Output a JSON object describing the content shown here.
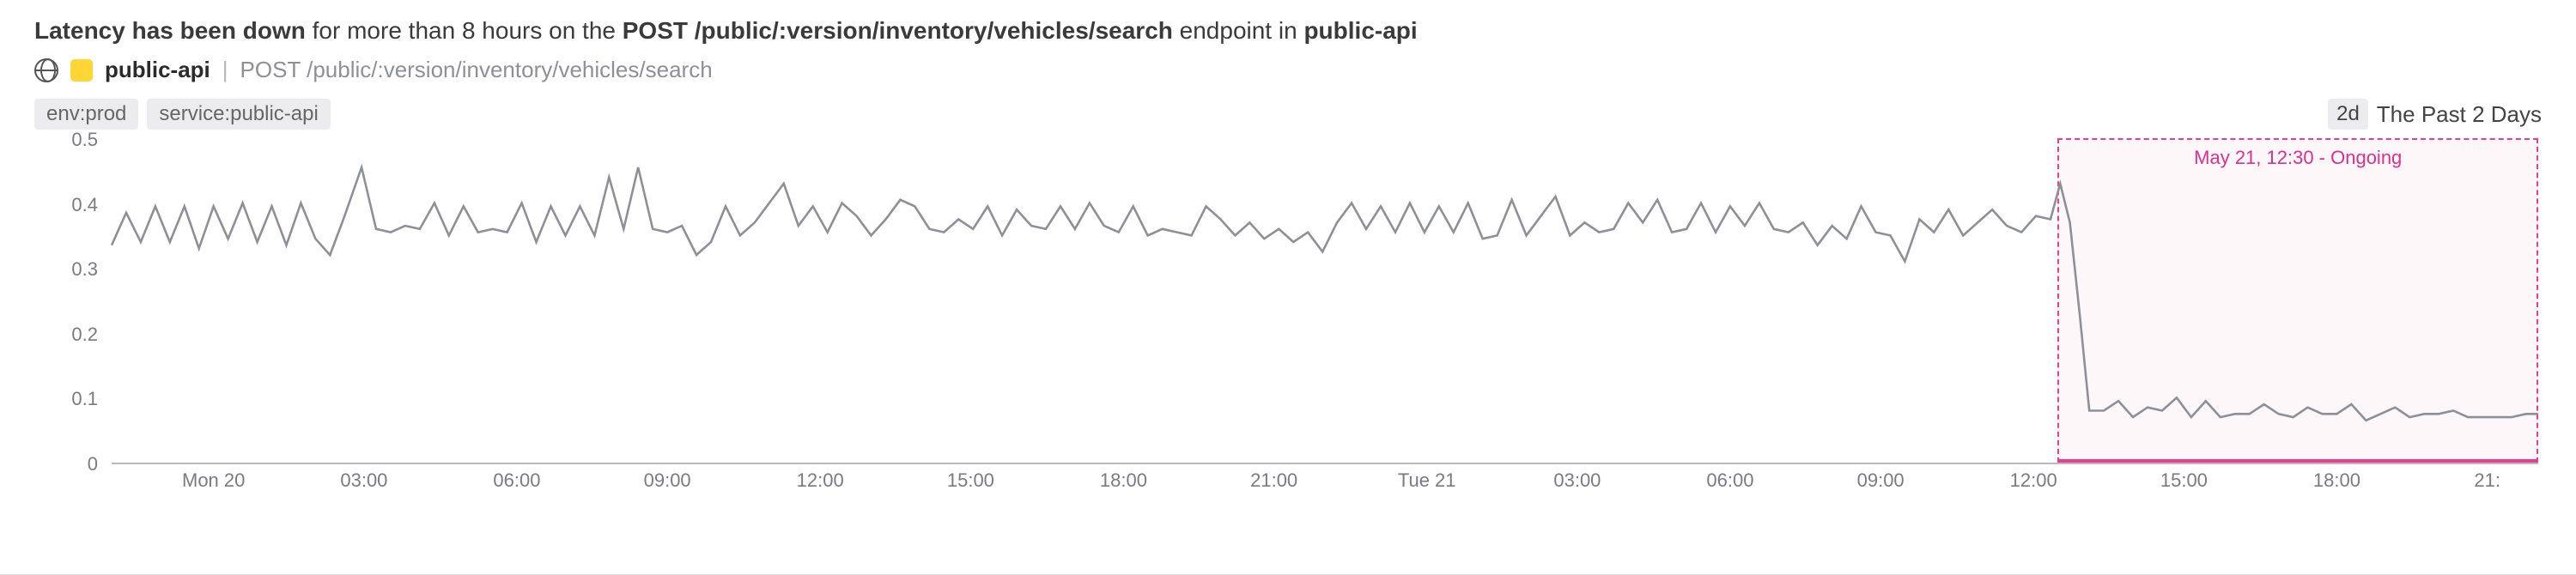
{
  "title": {
    "prefix_bold": "Latency has been down",
    "middle": " for more than 8 hours on the ",
    "endpoint_bold": "POST /public/:version/inventory/vehicles/search",
    "after_endpoint": " endpoint in ",
    "service_bold": "public-api"
  },
  "meta": {
    "service": "public-api",
    "separator": "|",
    "endpoint": "POST /public/:version/inventory/vehicles/search"
  },
  "tags": [
    "env:prod",
    "service:public-api"
  ],
  "time_range": {
    "badge": "2d",
    "label": "The Past 2 Days"
  },
  "highlight": {
    "label": "May 21, 12:30 - Ongoing"
  },
  "chart_data": {
    "type": "line",
    "title": "",
    "xlabel": "",
    "ylabel": "",
    "ylim": [
      0,
      0.5
    ],
    "y_ticks": [
      0,
      0.1,
      0.2,
      0.3,
      0.4,
      0.5
    ],
    "x_ticks": [
      {
        "pos": 0.042,
        "label": "Mon 20"
      },
      {
        "pos": 0.104,
        "label": "03:00"
      },
      {
        "pos": 0.167,
        "label": "06:00"
      },
      {
        "pos": 0.229,
        "label": "09:00"
      },
      {
        "pos": 0.292,
        "label": "12:00"
      },
      {
        "pos": 0.354,
        "label": "15:00"
      },
      {
        "pos": 0.417,
        "label": "18:00"
      },
      {
        "pos": 0.479,
        "label": "21:00"
      },
      {
        "pos": 0.542,
        "label": "Tue 21"
      },
      {
        "pos": 0.604,
        "label": "03:00"
      },
      {
        "pos": 0.667,
        "label": "06:00"
      },
      {
        "pos": 0.729,
        "label": "09:00"
      },
      {
        "pos": 0.792,
        "label": "12:00"
      },
      {
        "pos": 0.854,
        "label": "15:00"
      },
      {
        "pos": 0.917,
        "label": "18:00"
      },
      {
        "pos": 0.979,
        "label": "21:"
      }
    ],
    "highlight_region": {
      "start": 0.802,
      "end": 1.0
    },
    "series": [
      {
        "name": "latency",
        "points": [
          [
            0.0,
            0.335
          ],
          [
            0.006,
            0.385
          ],
          [
            0.012,
            0.34
          ],
          [
            0.018,
            0.395
          ],
          [
            0.024,
            0.34
          ],
          [
            0.03,
            0.395
          ],
          [
            0.036,
            0.33
          ],
          [
            0.042,
            0.395
          ],
          [
            0.048,
            0.345
          ],
          [
            0.054,
            0.4
          ],
          [
            0.06,
            0.34
          ],
          [
            0.066,
            0.395
          ],
          [
            0.072,
            0.335
          ],
          [
            0.078,
            0.4
          ],
          [
            0.084,
            0.345
          ],
          [
            0.09,
            0.32
          ],
          [
            0.096,
            0.38
          ],
          [
            0.103,
            0.455
          ],
          [
            0.109,
            0.36
          ],
          [
            0.115,
            0.355
          ],
          [
            0.121,
            0.365
          ],
          [
            0.127,
            0.36
          ],
          [
            0.133,
            0.4
          ],
          [
            0.139,
            0.35
          ],
          [
            0.145,
            0.395
          ],
          [
            0.151,
            0.355
          ],
          [
            0.157,
            0.36
          ],
          [
            0.163,
            0.355
          ],
          [
            0.169,
            0.4
          ],
          [
            0.175,
            0.34
          ],
          [
            0.181,
            0.395
          ],
          [
            0.187,
            0.35
          ],
          [
            0.193,
            0.395
          ],
          [
            0.199,
            0.35
          ],
          [
            0.205,
            0.44
          ],
          [
            0.211,
            0.36
          ],
          [
            0.217,
            0.455
          ],
          [
            0.223,
            0.36
          ],
          [
            0.229,
            0.355
          ],
          [
            0.235,
            0.365
          ],
          [
            0.241,
            0.32
          ],
          [
            0.247,
            0.34
          ],
          [
            0.253,
            0.395
          ],
          [
            0.259,
            0.35
          ],
          [
            0.265,
            0.37
          ],
          [
            0.271,
            0.4
          ],
          [
            0.277,
            0.43
          ],
          [
            0.283,
            0.365
          ],
          [
            0.289,
            0.395
          ],
          [
            0.295,
            0.355
          ],
          [
            0.301,
            0.4
          ],
          [
            0.307,
            0.38
          ],
          [
            0.313,
            0.35
          ],
          [
            0.319,
            0.375
          ],
          [
            0.325,
            0.405
          ],
          [
            0.331,
            0.395
          ],
          [
            0.337,
            0.36
          ],
          [
            0.343,
            0.355
          ],
          [
            0.349,
            0.375
          ],
          [
            0.355,
            0.36
          ],
          [
            0.361,
            0.395
          ],
          [
            0.367,
            0.35
          ],
          [
            0.373,
            0.39
          ],
          [
            0.379,
            0.365
          ],
          [
            0.385,
            0.36
          ],
          [
            0.391,
            0.395
          ],
          [
            0.397,
            0.36
          ],
          [
            0.403,
            0.4
          ],
          [
            0.409,
            0.365
          ],
          [
            0.415,
            0.355
          ],
          [
            0.421,
            0.395
          ],
          [
            0.427,
            0.35
          ],
          [
            0.433,
            0.36
          ],
          [
            0.439,
            0.355
          ],
          [
            0.445,
            0.35
          ],
          [
            0.451,
            0.395
          ],
          [
            0.457,
            0.375
          ],
          [
            0.463,
            0.35
          ],
          [
            0.469,
            0.37
          ],
          [
            0.475,
            0.345
          ],
          [
            0.481,
            0.36
          ],
          [
            0.487,
            0.34
          ],
          [
            0.493,
            0.355
          ],
          [
            0.499,
            0.325
          ],
          [
            0.505,
            0.37
          ],
          [
            0.511,
            0.4
          ],
          [
            0.517,
            0.36
          ],
          [
            0.523,
            0.395
          ],
          [
            0.529,
            0.355
          ],
          [
            0.535,
            0.4
          ],
          [
            0.541,
            0.355
          ],
          [
            0.547,
            0.395
          ],
          [
            0.553,
            0.355
          ],
          [
            0.559,
            0.4
          ],
          [
            0.565,
            0.345
          ],
          [
            0.571,
            0.35
          ],
          [
            0.577,
            0.405
          ],
          [
            0.583,
            0.35
          ],
          [
            0.589,
            0.38
          ],
          [
            0.595,
            0.41
          ],
          [
            0.601,
            0.35
          ],
          [
            0.607,
            0.37
          ],
          [
            0.613,
            0.355
          ],
          [
            0.619,
            0.36
          ],
          [
            0.625,
            0.4
          ],
          [
            0.631,
            0.37
          ],
          [
            0.637,
            0.405
          ],
          [
            0.643,
            0.355
          ],
          [
            0.649,
            0.36
          ],
          [
            0.655,
            0.4
          ],
          [
            0.661,
            0.355
          ],
          [
            0.667,
            0.395
          ],
          [
            0.673,
            0.365
          ],
          [
            0.679,
            0.4
          ],
          [
            0.685,
            0.36
          ],
          [
            0.691,
            0.355
          ],
          [
            0.697,
            0.37
          ],
          [
            0.703,
            0.335
          ],
          [
            0.709,
            0.365
          ],
          [
            0.715,
            0.345
          ],
          [
            0.721,
            0.395
          ],
          [
            0.727,
            0.355
          ],
          [
            0.733,
            0.35
          ],
          [
            0.739,
            0.31
          ],
          [
            0.745,
            0.375
          ],
          [
            0.751,
            0.355
          ],
          [
            0.757,
            0.39
          ],
          [
            0.763,
            0.35
          ],
          [
            0.769,
            0.37
          ],
          [
            0.775,
            0.39
          ],
          [
            0.781,
            0.365
          ],
          [
            0.787,
            0.355
          ],
          [
            0.793,
            0.38
          ],
          [
            0.799,
            0.375
          ],
          [
            0.803,
            0.43
          ],
          [
            0.807,
            0.37
          ],
          [
            0.811,
            0.23
          ],
          [
            0.815,
            0.08
          ],
          [
            0.821,
            0.08
          ],
          [
            0.827,
            0.095
          ],
          [
            0.833,
            0.07
          ],
          [
            0.839,
            0.085
          ],
          [
            0.845,
            0.08
          ],
          [
            0.851,
            0.1
          ],
          [
            0.857,
            0.07
          ],
          [
            0.863,
            0.095
          ],
          [
            0.869,
            0.07
          ],
          [
            0.875,
            0.075
          ],
          [
            0.881,
            0.075
          ],
          [
            0.887,
            0.09
          ],
          [
            0.893,
            0.075
          ],
          [
            0.899,
            0.07
          ],
          [
            0.905,
            0.085
          ],
          [
            0.911,
            0.075
          ],
          [
            0.917,
            0.075
          ],
          [
            0.923,
            0.09
          ],
          [
            0.929,
            0.065
          ],
          [
            0.935,
            0.075
          ],
          [
            0.941,
            0.085
          ],
          [
            0.947,
            0.07
          ],
          [
            0.953,
            0.075
          ],
          [
            0.959,
            0.075
          ],
          [
            0.965,
            0.08
          ],
          [
            0.971,
            0.07
          ],
          [
            0.977,
            0.07
          ],
          [
            0.983,
            0.07
          ],
          [
            0.989,
            0.07
          ],
          [
            0.995,
            0.075
          ],
          [
            1.0,
            0.075
          ]
        ]
      }
    ]
  }
}
